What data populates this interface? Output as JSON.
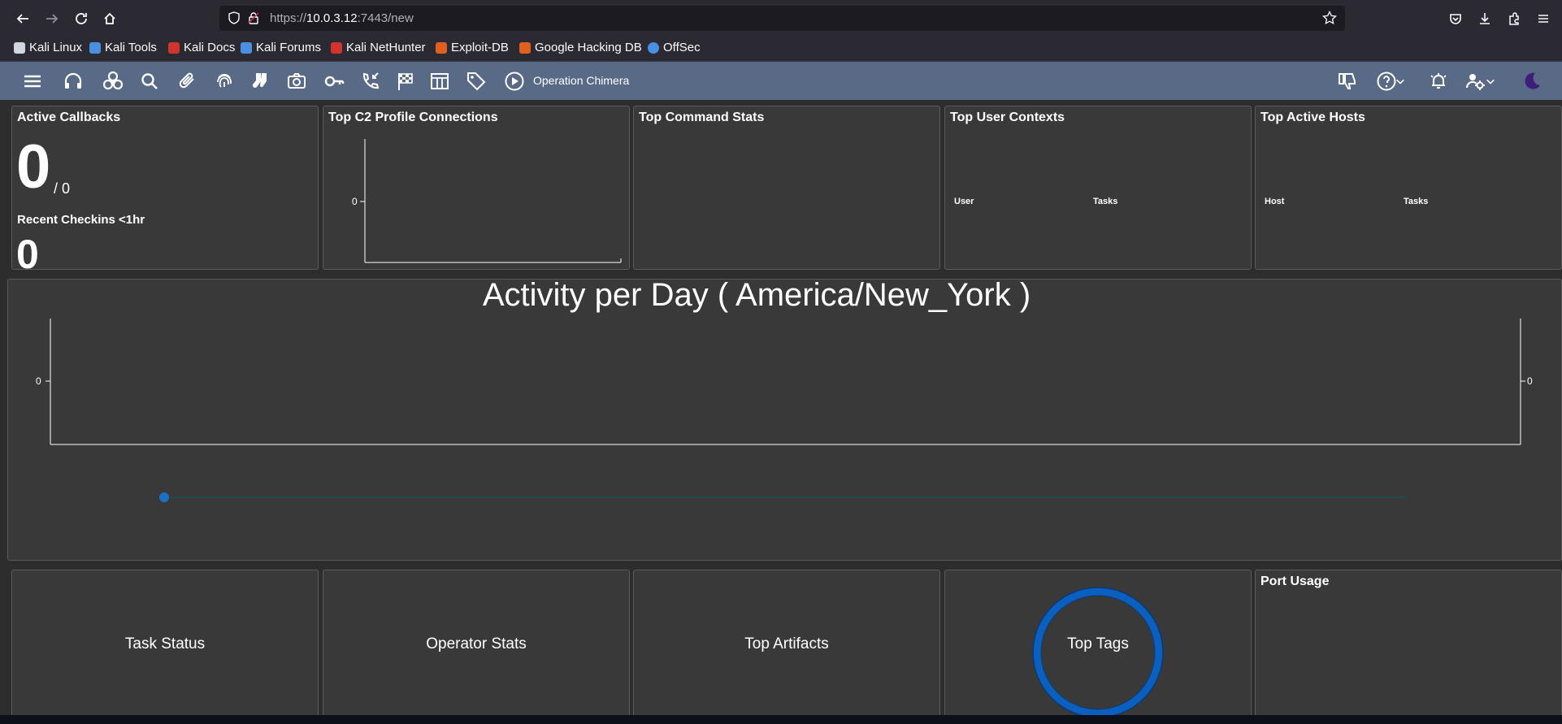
{
  "browser": {
    "url_prefix": "https://",
    "url_host": "10.0.3.12",
    "url_rest": ":7443/new",
    "bookmarks": [
      {
        "label": "Kali Linux",
        "color": "#cfd6e0"
      },
      {
        "label": "Kali Tools",
        "color": "#4a8fe0"
      },
      {
        "label": "Kali Docs",
        "color": "#d0342c"
      },
      {
        "label": "Kali Forums",
        "color": "#4a8fe0"
      },
      {
        "label": "Kali NetHunter",
        "color": "#d0342c"
      },
      {
        "label": "Exploit-DB",
        "color": "#e06020"
      },
      {
        "label": "Google Hacking DB",
        "color": "#e06020"
      },
      {
        "label": "OffSec",
        "color": "#4a8fe0"
      }
    ]
  },
  "appbar": {
    "operation_name": "Operation Chimera",
    "icons": [
      "menu-icon",
      "headphones-icon",
      "biohazard-icon",
      "search-icon",
      "paperclip-icon",
      "fingerprint-icon",
      "socks-icon",
      "camera-icon",
      "key-icon",
      "phone-callback-icon",
      "flag-icon",
      "table-icon",
      "tag-icon",
      "play-icon"
    ],
    "right_icons": [
      "thumbs-down-icon",
      "help-icon",
      "alerts-icon",
      "settings-icon",
      "moon-icon"
    ]
  },
  "cards": {
    "active_callbacks": {
      "title": "Active Callbacks",
      "count": "0",
      "total": "/ 0",
      "recent_label": "Recent Checkins <1hr",
      "recent_count": "0"
    },
    "top_c2": {
      "title": "Top C2 Profile Connections",
      "y_tick": "0"
    },
    "top_command": {
      "title": "Top Command Stats"
    },
    "top_user": {
      "title": "Top User Contexts",
      "col_user": "User",
      "col_tasks": "Tasks"
    },
    "top_hosts": {
      "title": "Top Active Hosts",
      "col_host": "Host",
      "col_tasks": "Tasks"
    }
  },
  "activity": {
    "title": "Activity per Day ( America/New_York )",
    "y_left": "0",
    "y_right": "0"
  },
  "bottom": {
    "task_status": "Task Status",
    "operator_stats": "Operator Stats",
    "top_artifacts": "Top Artifacts",
    "top_tags": "Top Tags",
    "port_usage": "Port Usage"
  },
  "colors": {
    "appbar": "#596a86",
    "accent": "#0b5fbf",
    "card": "#393939"
  },
  "chart_data": [
    {
      "type": "bar",
      "title": "Top C2 Profile Connections",
      "categories": [],
      "values": [],
      "ylim": [
        0,
        0
      ]
    },
    {
      "type": "line",
      "title": "Activity per Day ( America/New_York )",
      "x": [],
      "series": [],
      "ylim": [
        0,
        0
      ]
    },
    {
      "type": "pie",
      "title": "Top Tags",
      "values": [
        1
      ]
    }
  ]
}
